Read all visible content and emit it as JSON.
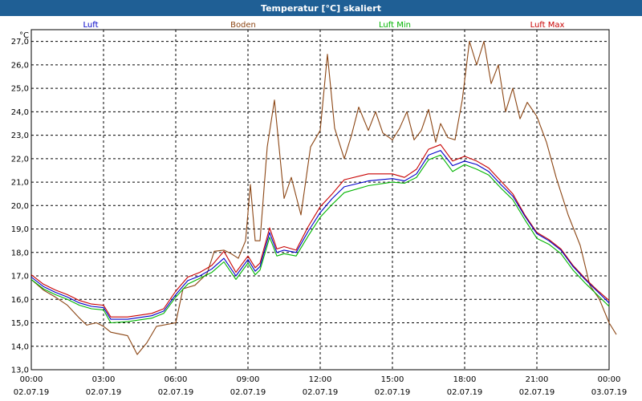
{
  "window": {
    "title": "Temperatur [°C] skaliert"
  },
  "chart_data": {
    "type": "line",
    "title": "Temperatur [°C] skaliert",
    "ylabel": "°C",
    "xlabel": "",
    "ylim": [
      13.0,
      27.5
    ],
    "xlim": [
      0,
      24
    ],
    "grid": true,
    "legend_position": "top",
    "y_ticks": [
      "13,0",
      "14,0",
      "15,0",
      "16,0",
      "17,0",
      "18,0",
      "19,0",
      "20,0",
      "21,0",
      "22,0",
      "23,0",
      "24,0",
      "25,0",
      "26,0",
      "27,0"
    ],
    "x_ticks": [
      {
        "time": "00:00",
        "date": "02.07.19"
      },
      {
        "time": "03:00",
        "date": "02.07.19"
      },
      {
        "time": "06:00",
        "date": "02.07.19"
      },
      {
        "time": "09:00",
        "date": "02.07.19"
      },
      {
        "time": "12:00",
        "date": "02.07.19"
      },
      {
        "time": "15:00",
        "date": "02.07.19"
      },
      {
        "time": "18:00",
        "date": "02.07.19"
      },
      {
        "time": "21:00",
        "date": "02.07.19"
      },
      {
        "time": "00:00",
        "date": "03.07.19"
      }
    ],
    "series": [
      {
        "name": "Luft",
        "color": "#0000c8",
        "points": [
          [
            0,
            16.95
          ],
          [
            0.5,
            16.55
          ],
          [
            1,
            16.3
          ],
          [
            1.5,
            16.1
          ],
          [
            2,
            15.85
          ],
          [
            2.5,
            15.7
          ],
          [
            3,
            15.65
          ],
          [
            3.3,
            15.15
          ],
          [
            4,
            15.15
          ],
          [
            5,
            15.3
          ],
          [
            5.5,
            15.5
          ],
          [
            6,
            16.2
          ],
          [
            6.5,
            16.8
          ],
          [
            7,
            17.0
          ],
          [
            7.5,
            17.3
          ],
          [
            8,
            17.75
          ],
          [
            8.5,
            17.0
          ],
          [
            9,
            17.7
          ],
          [
            9.3,
            17.2
          ],
          [
            9.5,
            17.4
          ],
          [
            9.9,
            18.85
          ],
          [
            10.2,
            18.0
          ],
          [
            10.5,
            18.1
          ],
          [
            11,
            18.0
          ],
          [
            11.5,
            18.9
          ],
          [
            12,
            19.7
          ],
          [
            12.5,
            20.3
          ],
          [
            13,
            20.8
          ],
          [
            14,
            21.05
          ],
          [
            15,
            21.15
          ],
          [
            15.5,
            21.05
          ],
          [
            16,
            21.35
          ],
          [
            16.5,
            22.15
          ],
          [
            17,
            22.35
          ],
          [
            17.5,
            21.7
          ],
          [
            18,
            21.9
          ],
          [
            18.5,
            21.75
          ],
          [
            19,
            21.45
          ],
          [
            19.5,
            20.9
          ],
          [
            20,
            20.4
          ],
          [
            20.5,
            19.55
          ],
          [
            21,
            18.8
          ],
          [
            21.5,
            18.5
          ],
          [
            22,
            18.1
          ],
          [
            22.5,
            17.4
          ],
          [
            23,
            16.85
          ],
          [
            23.5,
            16.35
          ],
          [
            24,
            15.85
          ]
        ]
      },
      {
        "name": "Boden",
        "color": "#8b4513",
        "points": [
          [
            0,
            16.85
          ],
          [
            0.5,
            16.4
          ],
          [
            1,
            16.1
          ],
          [
            1.5,
            15.75
          ],
          [
            2,
            15.2
          ],
          [
            2.3,
            14.9
          ],
          [
            2.7,
            15.0
          ],
          [
            3,
            14.85
          ],
          [
            3.3,
            14.6
          ],
          [
            4,
            14.45
          ],
          [
            4.4,
            13.65
          ],
          [
            4.8,
            14.15
          ],
          [
            5.2,
            14.85
          ],
          [
            6,
            15.0
          ],
          [
            6.3,
            16.45
          ],
          [
            6.8,
            16.6
          ],
          [
            7.3,
            17.1
          ],
          [
            7.6,
            18.05
          ],
          [
            8,
            18.1
          ],
          [
            8.3,
            17.95
          ],
          [
            8.6,
            17.75
          ],
          [
            8.9,
            18.5
          ],
          [
            9.1,
            20.9
          ],
          [
            9.3,
            18.5
          ],
          [
            9.5,
            18.5
          ],
          [
            9.8,
            22.5
          ],
          [
            10.1,
            24.5
          ],
          [
            10.5,
            20.3
          ],
          [
            10.8,
            21.2
          ],
          [
            11.2,
            19.6
          ],
          [
            11.6,
            22.5
          ],
          [
            12,
            23.2
          ],
          [
            12.3,
            26.45
          ],
          [
            12.6,
            23.3
          ],
          [
            13,
            22.0
          ],
          [
            13.3,
            23.0
          ],
          [
            13.6,
            24.2
          ],
          [
            14,
            23.2
          ],
          [
            14.3,
            24.0
          ],
          [
            14.6,
            23.1
          ],
          [
            15,
            22.8
          ],
          [
            15.3,
            23.3
          ],
          [
            15.6,
            24.0
          ],
          [
            15.9,
            22.8
          ],
          [
            16.2,
            23.2
          ],
          [
            16.5,
            24.1
          ],
          [
            16.8,
            22.7
          ],
          [
            17.0,
            23.5
          ],
          [
            17.3,
            22.9
          ],
          [
            17.6,
            22.8
          ],
          [
            17.9,
            24.5
          ],
          [
            18.2,
            27.0
          ],
          [
            18.5,
            26.0
          ],
          [
            18.8,
            27.0
          ],
          [
            19.1,
            25.2
          ],
          [
            19.4,
            26.0
          ],
          [
            19.7,
            24.0
          ],
          [
            20,
            25.0
          ],
          [
            20.3,
            23.7
          ],
          [
            20.6,
            24.4
          ],
          [
            21,
            23.8
          ],
          [
            21.4,
            22.7
          ],
          [
            21.8,
            21.2
          ],
          [
            22.3,
            19.6
          ],
          [
            22.8,
            18.3
          ],
          [
            23.2,
            16.6
          ],
          [
            23.6,
            16.0
          ],
          [
            24,
            15.0
          ],
          [
            24.3,
            14.5
          ]
        ]
      },
      {
        "name": "Luft Min",
        "color": "#00b400",
        "points": [
          [
            0,
            16.85
          ],
          [
            0.5,
            16.45
          ],
          [
            1,
            16.2
          ],
          [
            1.5,
            16.0
          ],
          [
            2,
            15.75
          ],
          [
            2.5,
            15.6
          ],
          [
            3,
            15.55
          ],
          [
            3.3,
            15.0
          ],
          [
            4,
            15.05
          ],
          [
            5,
            15.2
          ],
          [
            5.5,
            15.4
          ],
          [
            6,
            16.1
          ],
          [
            6.5,
            16.65
          ],
          [
            7,
            16.9
          ],
          [
            7.5,
            17.15
          ],
          [
            8,
            17.6
          ],
          [
            8.5,
            16.85
          ],
          [
            9,
            17.55
          ],
          [
            9.3,
            17.05
          ],
          [
            9.5,
            17.25
          ],
          [
            9.9,
            18.65
          ],
          [
            10.2,
            17.85
          ],
          [
            10.5,
            17.95
          ],
          [
            11,
            17.85
          ],
          [
            11.5,
            18.7
          ],
          [
            12,
            19.5
          ],
          [
            12.5,
            20.05
          ],
          [
            13,
            20.55
          ],
          [
            14,
            20.85
          ],
          [
            15,
            21.0
          ],
          [
            15.5,
            20.95
          ],
          [
            16,
            21.2
          ],
          [
            16.5,
            21.95
          ],
          [
            17,
            22.15
          ],
          [
            17.5,
            21.45
          ],
          [
            18,
            21.75
          ],
          [
            18.5,
            21.55
          ],
          [
            19,
            21.3
          ],
          [
            19.5,
            20.75
          ],
          [
            20,
            20.25
          ],
          [
            20.5,
            19.4
          ],
          [
            21,
            18.6
          ],
          [
            21.5,
            18.35
          ],
          [
            22,
            17.95
          ],
          [
            22.5,
            17.25
          ],
          [
            23,
            16.7
          ],
          [
            23.5,
            16.2
          ],
          [
            24,
            15.7
          ]
        ]
      },
      {
        "name": "Luft Max",
        "color": "#c80000",
        "points": [
          [
            0,
            17.05
          ],
          [
            0.5,
            16.65
          ],
          [
            1,
            16.4
          ],
          [
            1.5,
            16.2
          ],
          [
            2,
            15.95
          ],
          [
            2.5,
            15.8
          ],
          [
            3,
            15.75
          ],
          [
            3.3,
            15.25
          ],
          [
            4,
            15.25
          ],
          [
            5,
            15.4
          ],
          [
            5.5,
            15.6
          ],
          [
            6,
            16.35
          ],
          [
            6.5,
            16.95
          ],
          [
            7,
            17.15
          ],
          [
            7.5,
            17.45
          ],
          [
            8,
            18.05
          ],
          [
            8.5,
            17.15
          ],
          [
            9,
            17.85
          ],
          [
            9.3,
            17.35
          ],
          [
            9.5,
            17.55
          ],
          [
            9.9,
            19.05
          ],
          [
            10.2,
            18.15
          ],
          [
            10.5,
            18.25
          ],
          [
            11,
            18.1
          ],
          [
            11.5,
            19.1
          ],
          [
            12,
            19.95
          ],
          [
            12.5,
            20.5
          ],
          [
            13,
            21.1
          ],
          [
            14,
            21.35
          ],
          [
            15,
            21.35
          ],
          [
            15.5,
            21.2
          ],
          [
            16,
            21.55
          ],
          [
            16.5,
            22.4
          ],
          [
            17,
            22.6
          ],
          [
            17.5,
            21.9
          ],
          [
            18,
            22.1
          ],
          [
            18.5,
            21.9
          ],
          [
            19,
            21.6
          ],
          [
            19.5,
            21.05
          ],
          [
            20,
            20.5
          ],
          [
            20.5,
            19.6
          ],
          [
            21,
            18.85
          ],
          [
            21.5,
            18.55
          ],
          [
            22,
            18.15
          ],
          [
            22.5,
            17.45
          ],
          [
            23,
            16.9
          ],
          [
            23.5,
            16.4
          ],
          [
            24,
            15.95
          ]
        ]
      }
    ]
  }
}
